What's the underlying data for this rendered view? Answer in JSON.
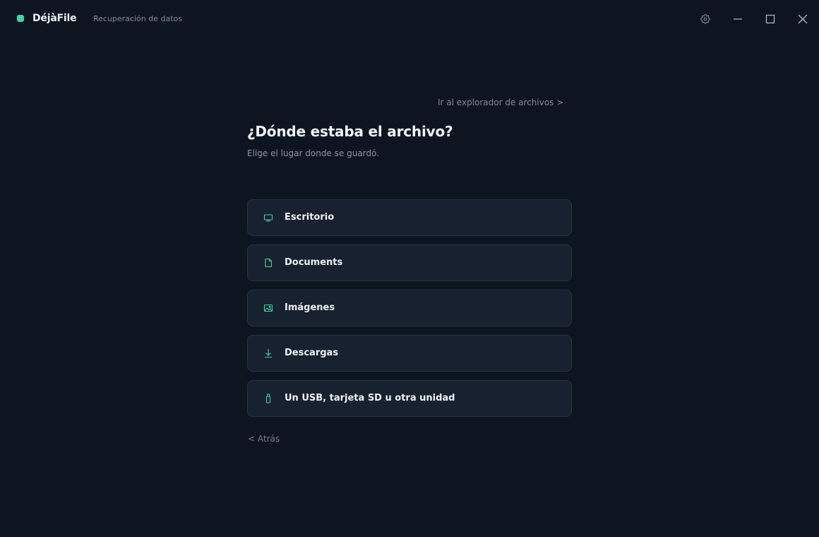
{
  "app": {
    "name": "DéjàFile",
    "subtitle": "Recuperación de datos",
    "accent_color": "#3dd6a5"
  },
  "window_controls": {
    "settings_icon": "gear-icon",
    "minimize_icon": "minimize-icon",
    "maximize_icon": "maximize-icon",
    "close_icon": "close-icon"
  },
  "main": {
    "explorer_link": "Ir al explorador de archivos >",
    "title": "¿Dónde estaba el archivo?",
    "subtitle": "Elige el lugar donde se guardó.",
    "options": [
      {
        "label": "Escritorio",
        "icon": "monitor-icon"
      },
      {
        "label": "Documents",
        "icon": "document-icon"
      },
      {
        "label": "Imágenes",
        "icon": "image-icon"
      },
      {
        "label": "Descargas",
        "icon": "download-icon"
      },
      {
        "label": "Un USB, tarjeta SD u otra unidad",
        "icon": "usb-drive-icon"
      }
    ],
    "back_link": "< Atrás"
  }
}
